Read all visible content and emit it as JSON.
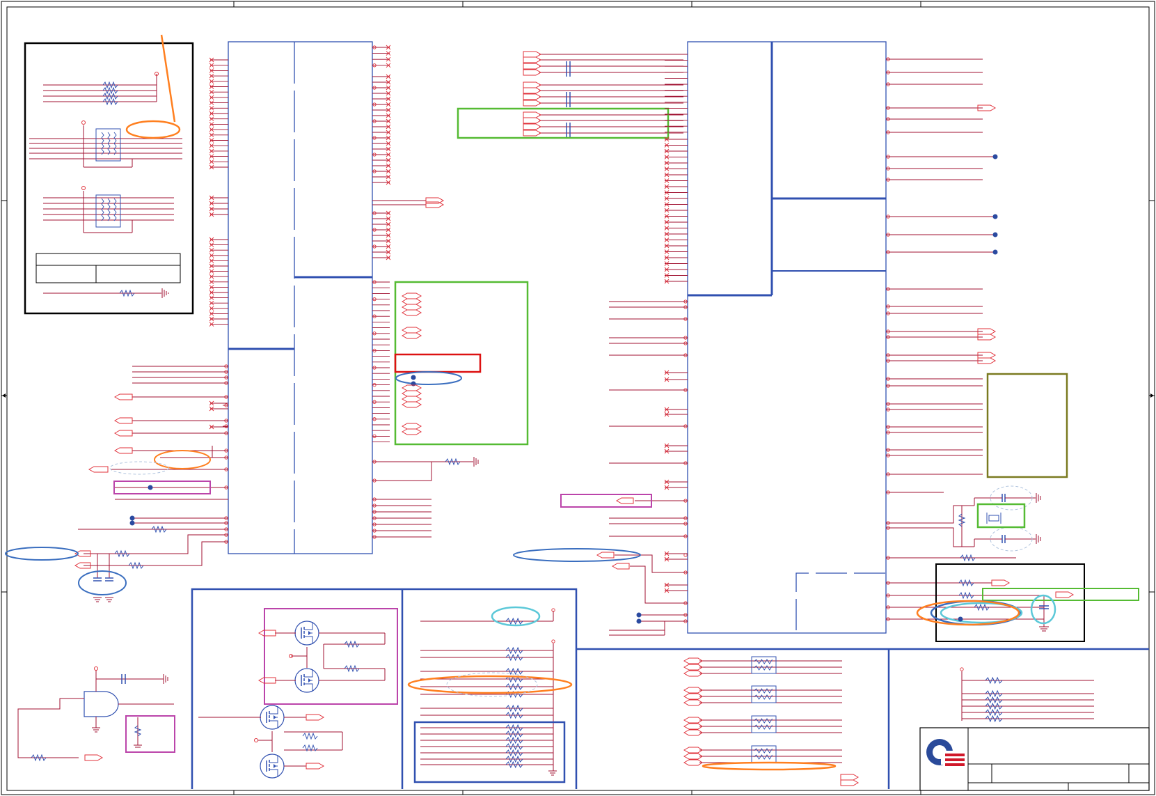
{
  "sheet": {
    "background": "#ffffff",
    "colors": {
      "wire": "#a01030",
      "pin": "#e0303a",
      "block_outline": "#3050b0",
      "frame": "#000000",
      "highlight_green": "#55bb33",
      "highlight_red": "#dd1111",
      "highlight_magenta": "#bb44aa",
      "highlight_olive": "#7a7a20",
      "ellipse_orange": "#ff7f1f",
      "ellipse_blue": "#3a6ebf",
      "ellipse_cyan": "#5bc8d8",
      "junction": "#2a4aa0"
    },
    "icons": [
      "resistor-icon",
      "capacitor-icon",
      "ground-icon",
      "mosfet-icon",
      "and-gate-icon",
      "crystal-icon",
      "resistor-network-icon",
      "company-logo-icon"
    ]
  },
  "title_block": {
    "logo": "company-logo-icon",
    "fields": [
      "",
      "",
      "",
      ""
    ]
  }
}
